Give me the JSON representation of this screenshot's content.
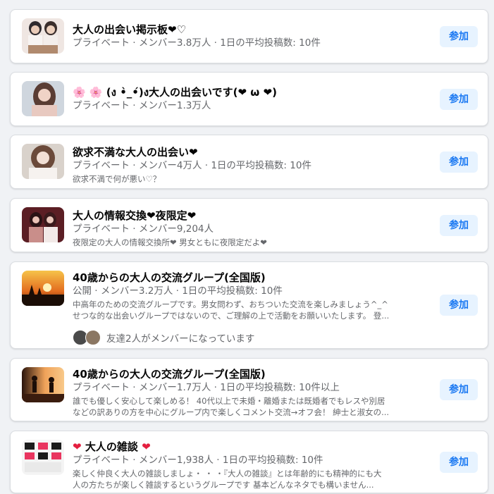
{
  "groups": [
    {
      "title": "大人の出会い掲示板❤♡",
      "meta": "プライベート · メンバー3.8万人 · 1日の平均投稿数: 10件",
      "desc": [],
      "join_label": "参加",
      "thumb_colors": [
        "#e9dedb",
        "#2e2a2e",
        "#d6b9a7"
      ]
    },
    {
      "title": "🌸 🌸 (ง •̀_•́)ง大人の出会いです(❤ ω ❤)",
      "meta": "プライベート · メンバー1.3万人",
      "desc": [],
      "join_label": "参加",
      "thumb_colors": [
        "#cdd4dc",
        "#5a3d34",
        "#efd6cf"
      ]
    },
    {
      "title": "欲求不満な大人の出会い❤",
      "meta": "プライベート · メンバー4万人 · 1日の平均投稿数: 10件",
      "desc": [
        "欲求不満で何が悪い♡？"
      ],
      "join_label": "参加",
      "thumb_colors": [
        "#d7d0c9",
        "#6b4a3a",
        "#f1e4dc"
      ]
    },
    {
      "title": "大人の情報交換❤夜限定❤",
      "meta": "プライベート · メンバー9,204人",
      "desc": [
        "夜限定の大人の情報交換所❤ 男女ともに夜限定だよ❤"
      ],
      "join_label": "参加",
      "thumb_colors": [
        "#5b1e24",
        "#c98e8a",
        "#2a1315"
      ]
    },
    {
      "title": "40歳からの大人の交流グループ(全国版)",
      "meta": "公開 · メンバー3.2万人 · 1日の平均投稿数: 10件",
      "desc": [
        "中高年のための交流グループです。男女問わず、おちついた交流を楽しみましょう^_^",
        "せつな的な出会いグループではないので、ご理解の上で活動をお願いいたします。 登..."
      ],
      "friends_text": "友達2人がメンバーになっています",
      "join_label": "参加",
      "thumb_colors": [
        "#f2a12a",
        "#1a0d06",
        "#e26a1e"
      ]
    },
    {
      "title": "40歳からの大人の交流グループ(全国版)",
      "meta": "プライベート · メンバー1.7万人 · 1日の平均投稿数: 10件以上",
      "desc": [
        "誰でも優しく安心して楽しめる！ 40代以上で未婚・離婚または既婚者でもレスや別居",
        "などの訳ありの方を中心にグループ内で楽しくコメント交流→オフ会！ 紳士と淑女の..."
      ],
      "join_label": "参加",
      "thumb_colors": [
        "#f0a35a",
        "#2a140c",
        "#f8c98a"
      ]
    },
    {
      "title": "大人の雑談",
      "meta": "プライベート · メンバー1,938人 · 1日の平均投稿数: 10件",
      "desc": [
        "楽しく仲良く大人の雑談しましょ・ ・ ・『大人の雑談』とは年齢的にも精神的にも大",
        "人の方たちが楽しく雑談するというグループです 基本どんなネタでも構いません..."
      ],
      "join_label": "参加",
      "thumb_colors": [
        "#e9355f",
        "#1b1b1b",
        "#f4f4f4"
      ]
    }
  ]
}
